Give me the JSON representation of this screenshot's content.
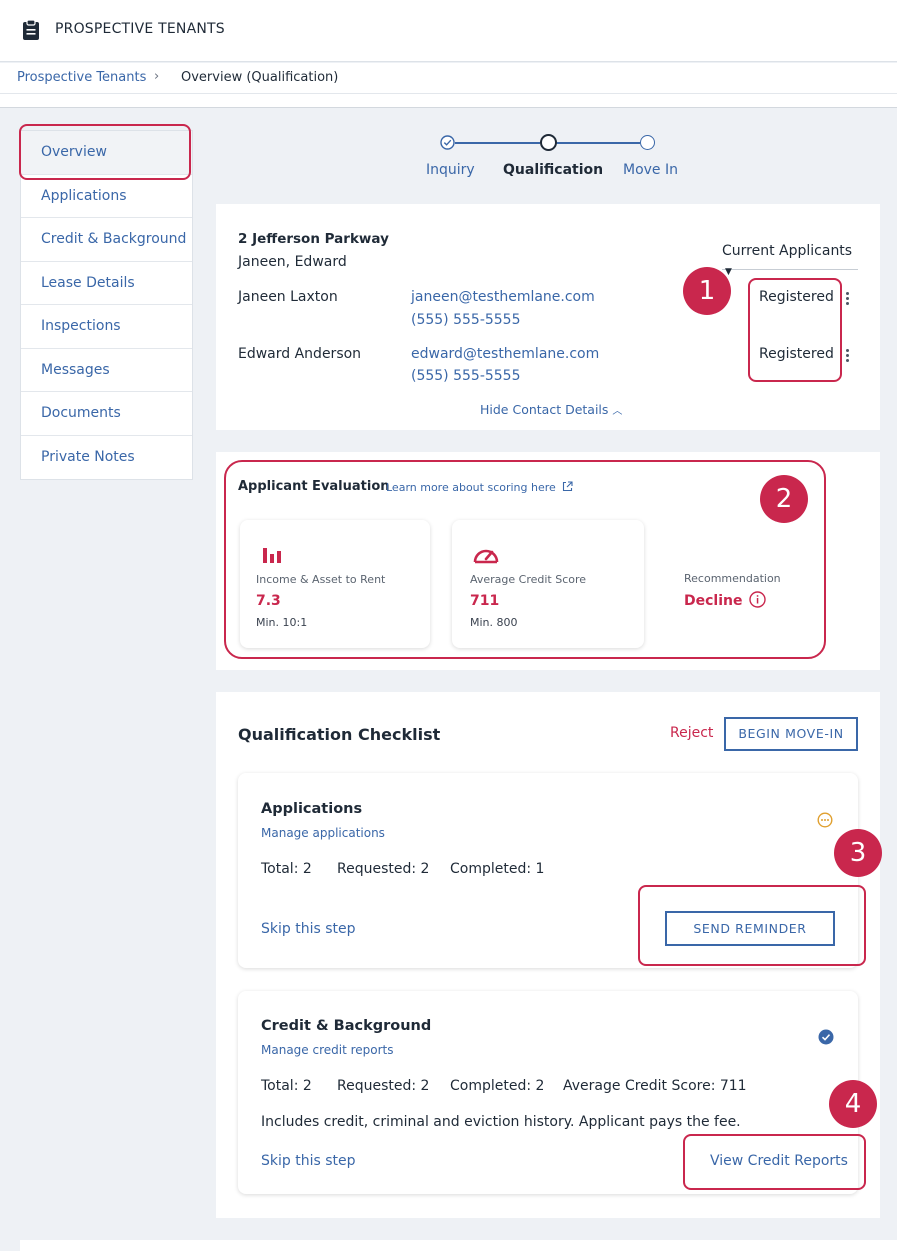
{
  "header": {
    "title": "PROSPECTIVE TENANTS"
  },
  "breadcrumb": {
    "parent": "Prospective Tenants",
    "separator": "›",
    "current": "Overview (Qualification)"
  },
  "sidebar": {
    "items": [
      {
        "label": "Overview"
      },
      {
        "label": "Applications"
      },
      {
        "label": "Credit & Background"
      },
      {
        "label": "Lease Details"
      },
      {
        "label": "Inspections"
      },
      {
        "label": "Messages"
      },
      {
        "label": "Documents"
      },
      {
        "label": "Private Notes"
      }
    ]
  },
  "stepper": {
    "steps": [
      {
        "label": "Inquiry",
        "state": "done"
      },
      {
        "label": "Qualification",
        "state": "current"
      },
      {
        "label": "Move In",
        "state": "upcoming"
      }
    ]
  },
  "property": {
    "address": "2 Jefferson Parkway",
    "names": "Janeen, Edward",
    "applicants_dropdown": "Current Applicants",
    "applicants": [
      {
        "name": "Janeen Laxton",
        "email": "janeen@testhemlane.com",
        "phone": "(555) 555-5555",
        "status": "Registered"
      },
      {
        "name": "Edward Anderson",
        "email": "edward@testhemlane.com",
        "phone": "(555) 555-5555",
        "status": "Registered"
      }
    ],
    "hide_contact": "Hide Contact Details"
  },
  "badges": [
    "1",
    "2",
    "3",
    "4"
  ],
  "evaluation": {
    "title": "Applicant Evaluation",
    "learn_more": "Learn more about scoring here",
    "income": {
      "label": "Income & Asset to Rent",
      "value": "7.3",
      "min": "Min. 10:1"
    },
    "credit": {
      "label": "Average Credit Score",
      "value": "711",
      "min": "Min. 800"
    },
    "recommendation": {
      "label": "Recommendation",
      "value": "Decline"
    }
  },
  "checklist": {
    "title": "Qualification Checklist",
    "reject": "Reject",
    "begin": "BEGIN MOVE-IN",
    "applications": {
      "title": "Applications",
      "manage": "Manage applications",
      "total": "Total: 2",
      "requested": "Requested: 2",
      "completed": "Completed: 1",
      "skip": "Skip this step",
      "action": "SEND REMINDER"
    },
    "credit": {
      "title": "Credit & Background",
      "manage": "Manage credit reports",
      "total": "Total: 2",
      "requested": "Requested: 2",
      "completed": "Completed: 2",
      "average": "Average Credit Score: 711",
      "note": "Includes credit, criminal and eviction history. Applicant pays the fee.",
      "skip": "Skip this step",
      "action": "View Credit Reports"
    }
  },
  "colors": {
    "accent": "#3a67a8",
    "highlight": "#c9274d",
    "pending": "#e0a030"
  }
}
